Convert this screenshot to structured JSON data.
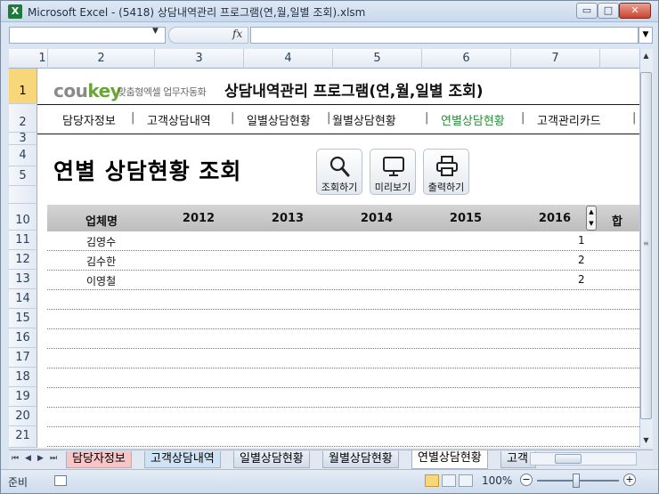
{
  "window": {
    "app_icon": "X",
    "title": "Microsoft Excel - (5418) 상담내역관리 프로그램(연,월,일별 조회).xlsm",
    "min_label": "▭",
    "max_label": "□",
    "close_label": "✕"
  },
  "formula_bar": {
    "name_box": "",
    "fx_label": "fx",
    "formula": ""
  },
  "columns": [
    "1",
    "2",
    "3",
    "4",
    "5",
    "6",
    "7"
  ],
  "rows": [
    "1",
    "2",
    "3",
    "4",
    "5",
    "10",
    "11",
    "12",
    "13",
    "14",
    "15",
    "16",
    "17",
    "18",
    "19",
    "20",
    "21"
  ],
  "selected_row": "1",
  "logo": {
    "brand_a": "cou",
    "brand_b": "key",
    "tagline": "맞춤형엑셀 업무자동화",
    "brand_color": "#8a8a8a",
    "accent_color": "#6aa538"
  },
  "app_title": "상담내역관리 프로그램(연,월,일별 조회)",
  "menu": {
    "items": [
      "담당자정보",
      "고객상담내역",
      "일별상담현황",
      "월별상담현황",
      "연별상담현황",
      "고객관리카드"
    ],
    "active": "연별상담현황",
    "active_color": "#2a8a3a",
    "separator": "|"
  },
  "page_title": "연별 상담현황 조회",
  "toolbar": {
    "search_label": "조회하기",
    "preview_label": "미리보기",
    "print_label": "출력하기"
  },
  "table": {
    "headers": [
      "업체명",
      "2012",
      "2013",
      "2014",
      "2015",
      "2016"
    ],
    "overflow_header": "합",
    "rows": [
      {
        "name": "김영수",
        "value": "1"
      },
      {
        "name": "김수한",
        "value": "2"
      },
      {
        "name": "이영철",
        "value": "2"
      }
    ]
  },
  "sheet_tabs": {
    "nav": [
      "⏮",
      "◀",
      "▶",
      "⏭"
    ],
    "tabs": [
      "담당자정보",
      "고객상담내역",
      "일별상담현황",
      "월별상담현황",
      "연별상담현황",
      "고객"
    ],
    "active": "연별상담현황"
  },
  "status": {
    "ready": "준비",
    "zoom": "100%",
    "zoom_minus": "−",
    "zoom_plus": "+"
  }
}
